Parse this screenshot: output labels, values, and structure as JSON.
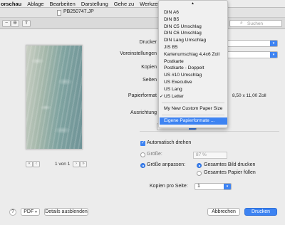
{
  "menubar": {
    "items": [
      "orschau",
      "Ablage",
      "Bearbeiten",
      "Darstellung",
      "Gehe zu",
      "Werkzeuge"
    ]
  },
  "window": {
    "title": "PB250747.JP",
    "search_placeholder": "Suchen"
  },
  "preview": {
    "page_counter": "1 von 1"
  },
  "print": {
    "printer_label": "Drucker",
    "presets_label": "Voreinstellungen",
    "copies_label": "Kopien",
    "pages_label": "Seiten",
    "paper_format_label": "Papierformat",
    "paper_size_text": "8,50 x 11,00 Zoll",
    "orientation_label": "Ausrichtung",
    "section_value": "Vorschau",
    "auto_rotate_label": "Automatisch drehen",
    "size_label": "Größe:",
    "size_value": "87 %",
    "fit_label": "Größe anpassen:",
    "print_entire_image": "Gesamtes Bild drucken",
    "fill_entire_paper": "Gesamtes Papier füllen",
    "pages_per_sheet_label": "Kopien pro Seite:",
    "pages_per_sheet_value": "1"
  },
  "paper_menu": {
    "items": [
      {
        "label": "DIN A6"
      },
      {
        "label": "DIN B5"
      },
      {
        "label": "DIN C5 Umschlag"
      },
      {
        "label": "DIN C6 Umschlag"
      },
      {
        "label": "DIN Lang Umschlag"
      },
      {
        "label": "JIS B5"
      },
      {
        "label": "Kartenumschlag 4,4x6 Zoll"
      },
      {
        "label": "Postkarte"
      },
      {
        "label": "Postkarte - Doppelt"
      },
      {
        "label": "US #10 Umschlag"
      },
      {
        "label": "US Executive"
      },
      {
        "label": "US Lang"
      },
      {
        "label": "US Letter",
        "checked": true
      }
    ],
    "custom_item": "My New Custom Paper Size",
    "manage_item": "Eigene Papierformate ...",
    "check_mark": "✓"
  },
  "footer": {
    "help_label": "?",
    "pdf_label": "PDF",
    "details_label": "Details ausblenden",
    "cancel_label": "Abbrechen",
    "print_label": "Drucken"
  },
  "colors": {
    "accent": "#3d83f2"
  }
}
